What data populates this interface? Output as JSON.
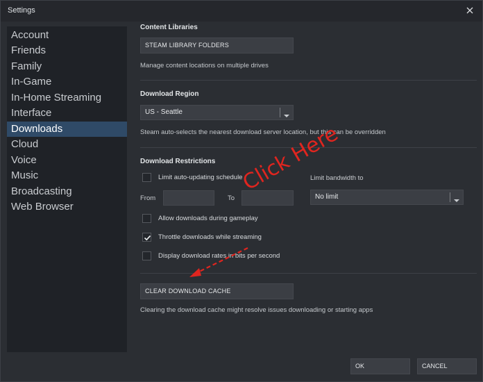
{
  "window": {
    "title": "Settings"
  },
  "colors": {
    "accent_selected": "#2f4a67",
    "annotation": "#e0251f"
  },
  "sidebar": {
    "items": [
      {
        "label": "Account"
      },
      {
        "label": "Friends"
      },
      {
        "label": "Family"
      },
      {
        "label": "In-Game"
      },
      {
        "label": "In-Home Streaming"
      },
      {
        "label": "Interface"
      },
      {
        "label": "Downloads",
        "selected": true
      },
      {
        "label": "Cloud"
      },
      {
        "label": "Voice"
      },
      {
        "label": "Music"
      },
      {
        "label": "Broadcasting"
      },
      {
        "label": "Web Browser"
      }
    ]
  },
  "content_libraries": {
    "title": "Content Libraries",
    "button_label": "STEAM LIBRARY FOLDERS",
    "description": "Manage content locations on multiple drives"
  },
  "download_region": {
    "title": "Download Region",
    "selected": "US - Seattle",
    "description": "Steam auto-selects the nearest download server location, but this can be overridden"
  },
  "download_restrictions": {
    "title": "Download Restrictions",
    "limit_schedule": {
      "label": "Limit auto-updating schedule",
      "checked": false
    },
    "from_label": "From",
    "to_label": "To",
    "bandwidth_label": "Limit bandwidth to",
    "bandwidth_selected": "No limit",
    "allow_gameplay": {
      "label": "Allow downloads during gameplay",
      "checked": false
    },
    "throttle": {
      "label": "Throttle downloads while streaming",
      "checked": true
    },
    "bits_per_second": {
      "label": "Display download rates in bits per second",
      "checked": false
    }
  },
  "cache": {
    "button_label": "CLEAR DOWNLOAD CACHE",
    "description": "Clearing the download cache might resolve issues downloading or starting apps"
  },
  "annotation": {
    "text": "Click Here"
  },
  "footer": {
    "ok_label": "OK",
    "cancel_label": "CANCEL"
  }
}
